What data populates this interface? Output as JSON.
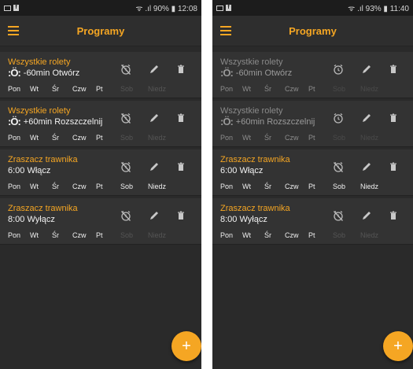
{
  "colors": {
    "accent": "#f5a623",
    "background": "#2a2a2a",
    "card": "#333333"
  },
  "screens": [
    {
      "status": {
        "right": "ᯤ .ıl 90% ▮ 12:08"
      },
      "header": {
        "title": "Programy"
      },
      "cards": [
        {
          "title": "Wszystkie rolety",
          "action": "-60min  Otwórz",
          "icon": "sunrise-icon",
          "days": [
            {
              "label": "Pon",
              "on": true
            },
            {
              "label": "Wt",
              "on": true
            },
            {
              "label": "Śr",
              "on": true
            },
            {
              "label": "Czw",
              "on": true
            },
            {
              "label": "Pt",
              "on": true
            },
            {
              "label": "Sob",
              "on": false
            },
            {
              "label": "Niedz",
              "on": false
            }
          ]
        },
        {
          "title": "Wszystkie rolety",
          "action": "+60min  Rozszczelnij",
          "icon": "sunset-icon",
          "days": [
            {
              "label": "Pon",
              "on": true
            },
            {
              "label": "Wt",
              "on": true
            },
            {
              "label": "Śr",
              "on": true
            },
            {
              "label": "Czw",
              "on": true
            },
            {
              "label": "Pt",
              "on": true
            },
            {
              "label": "Sob",
              "on": false
            },
            {
              "label": "Niedz",
              "on": false
            }
          ]
        },
        {
          "title": "Zraszacz trawnika",
          "action": "6:00  Włącz",
          "icon": "",
          "days": [
            {
              "label": "Pon",
              "on": true
            },
            {
              "label": "Wt",
              "on": true
            },
            {
              "label": "Śr",
              "on": true
            },
            {
              "label": "Czw",
              "on": true
            },
            {
              "label": "Pt",
              "on": true
            },
            {
              "label": "Sob",
              "on": true
            },
            {
              "label": "Niedz",
              "on": true
            }
          ]
        },
        {
          "title": "Zraszacz trawnika",
          "action": "8:00  Wyłącz",
          "icon": "",
          "days": [
            {
              "label": "Pon",
              "on": true
            },
            {
              "label": "Wt",
              "on": true
            },
            {
              "label": "Śr",
              "on": true
            },
            {
              "label": "Czw",
              "on": true
            },
            {
              "label": "Pt",
              "on": true
            },
            {
              "label": "Sob",
              "on": false
            },
            {
              "label": "Niedz",
              "on": false
            }
          ]
        }
      ],
      "alarm_states": [
        "off",
        "off",
        "off",
        "off"
      ],
      "fab_label": "+"
    },
    {
      "status": {
        "right": "ᯤ .ıl 93% ▮ 11:40"
      },
      "header": {
        "title": "Programy"
      },
      "cards": [
        {
          "title": "Wszystkie rolety",
          "action": "-60min  Otwórz",
          "icon": "sunrise-icon",
          "disabled": true,
          "days": [
            {
              "label": "Pon",
              "on": true
            },
            {
              "label": "Wt",
              "on": true
            },
            {
              "label": "Śr",
              "on": true
            },
            {
              "label": "Czw",
              "on": true
            },
            {
              "label": "Pt",
              "on": true
            },
            {
              "label": "Sob",
              "on": false
            },
            {
              "label": "Niedz",
              "on": false
            }
          ]
        },
        {
          "title": "Wszystkie rolety",
          "action": "+60min  Rozszczelnij",
          "icon": "sunset-icon",
          "disabled": true,
          "days": [
            {
              "label": "Pon",
              "on": true
            },
            {
              "label": "Wt",
              "on": true
            },
            {
              "label": "Śr",
              "on": true
            },
            {
              "label": "Czw",
              "on": true
            },
            {
              "label": "Pt",
              "on": true
            },
            {
              "label": "Sob",
              "on": false
            },
            {
              "label": "Niedz",
              "on": false
            }
          ]
        },
        {
          "title": "Zraszacz trawnika",
          "action": "6:00  Włącz",
          "icon": "",
          "days": [
            {
              "label": "Pon",
              "on": true
            },
            {
              "label": "Wt",
              "on": true
            },
            {
              "label": "Śr",
              "on": true
            },
            {
              "label": "Czw",
              "on": true
            },
            {
              "label": "Pt",
              "on": true
            },
            {
              "label": "Sob",
              "on": true
            },
            {
              "label": "Niedz",
              "on": true
            }
          ]
        },
        {
          "title": "Zraszacz trawnika",
          "action": "8:00  Wyłącz",
          "icon": "",
          "days": [
            {
              "label": "Pon",
              "on": true
            },
            {
              "label": "Wt",
              "on": true
            },
            {
              "label": "Śr",
              "on": true
            },
            {
              "label": "Czw",
              "on": true
            },
            {
              "label": "Pt",
              "on": true
            },
            {
              "label": "Sob",
              "on": false
            },
            {
              "label": "Niedz",
              "on": false
            }
          ]
        }
      ],
      "alarm_states": [
        "on",
        "on",
        "off",
        "off"
      ],
      "fab_label": "+"
    }
  ]
}
